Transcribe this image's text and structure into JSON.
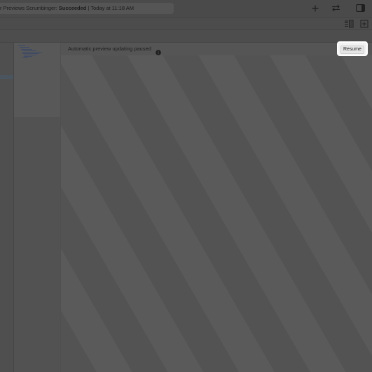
{
  "toolbar": {
    "activity": {
      "prefix": "r Previews Scrumbinger: ",
      "status": "Succeeded",
      "separator": " | ",
      "time": "Today at 11:18 AM"
    },
    "icons": [
      "plus-icon",
      "swap-arrows-icon",
      "sidebar-toggle-icon"
    ]
  },
  "tabbar": {
    "icons": [
      "editor-options-icon",
      "add-editor-icon"
    ]
  },
  "preview": {
    "paused_message": "Automatic preview updating paused",
    "resume_label": "Resume"
  }
}
